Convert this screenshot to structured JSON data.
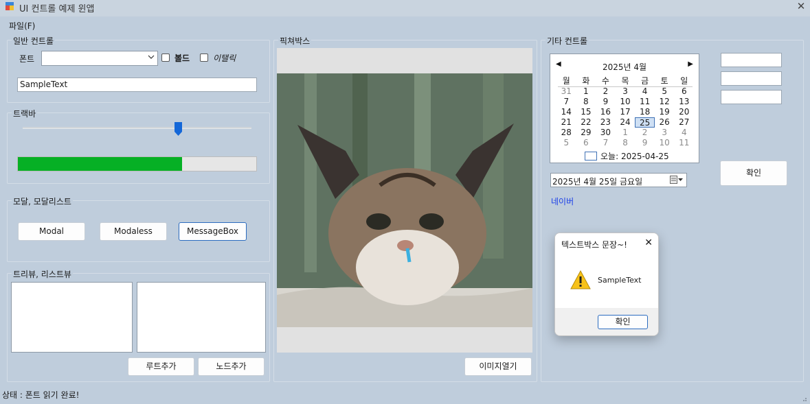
{
  "window": {
    "title": "UI 컨트롤 예제 윈앱"
  },
  "menu": {
    "file": "파일(F)"
  },
  "general_controls": {
    "group_title": "일반 컨트롤",
    "font_label": "폰트",
    "font_combo_value": "",
    "bold_label": "볼드",
    "italic_label": "이탤릭",
    "text_value": "SampleText"
  },
  "trackbar": {
    "group_title": "트랙바",
    "slider_fraction": 0.68,
    "progress_fraction": 0.69
  },
  "modal_group": {
    "group_title": "모달, 모달리스트",
    "modal_button": "Modal",
    "modaless_button": "Modaless",
    "messagebox_button": "MessageBox"
  },
  "tree_group": {
    "group_title": "트리뷰, 리스트뷰",
    "add_root_button": "루트추가",
    "add_node_button": "노드추가"
  },
  "picturebox": {
    "group_title": "픽쳐박스",
    "open_image_button": "이미지열기",
    "image_desc": "cat with tufted ears"
  },
  "other_controls": {
    "group_title": "기타 컨트롤",
    "calendar": {
      "header": "2025년 4월",
      "weekdays": [
        "월",
        "화",
        "수",
        "목",
        "금",
        "토",
        "일"
      ],
      "weeks": [
        [
          "31",
          "1",
          "2",
          "3",
          "4",
          "5",
          "6"
        ],
        [
          "7",
          "8",
          "9",
          "10",
          "11",
          "12",
          "13"
        ],
        [
          "14",
          "15",
          "16",
          "17",
          "18",
          "19",
          "20"
        ],
        [
          "21",
          "22",
          "23",
          "24",
          "25",
          "26",
          "27"
        ],
        [
          "28",
          "29",
          "30",
          "1",
          "2",
          "3",
          "4"
        ],
        [
          "5",
          "6",
          "7",
          "8",
          "9",
          "10",
          "11"
        ]
      ],
      "selected": "25",
      "today_label": "오늘: 2025-04-25"
    },
    "date_picker_value": "2025년   4월 25일 금요일",
    "link_text": "네이버",
    "textboxes": [
      "",
      "",
      ""
    ],
    "confirm_button": "확인"
  },
  "messagebox": {
    "title": "텍스트박스 문장~!",
    "message": "SampleText",
    "ok_button": "확인"
  },
  "status": {
    "text": "상태 : 폰트 읽기 완료!"
  },
  "colors": {
    "background": "#bfcddc",
    "progress": "#06b025",
    "accent": "#3f71b5",
    "link": "#1a3ee8"
  }
}
